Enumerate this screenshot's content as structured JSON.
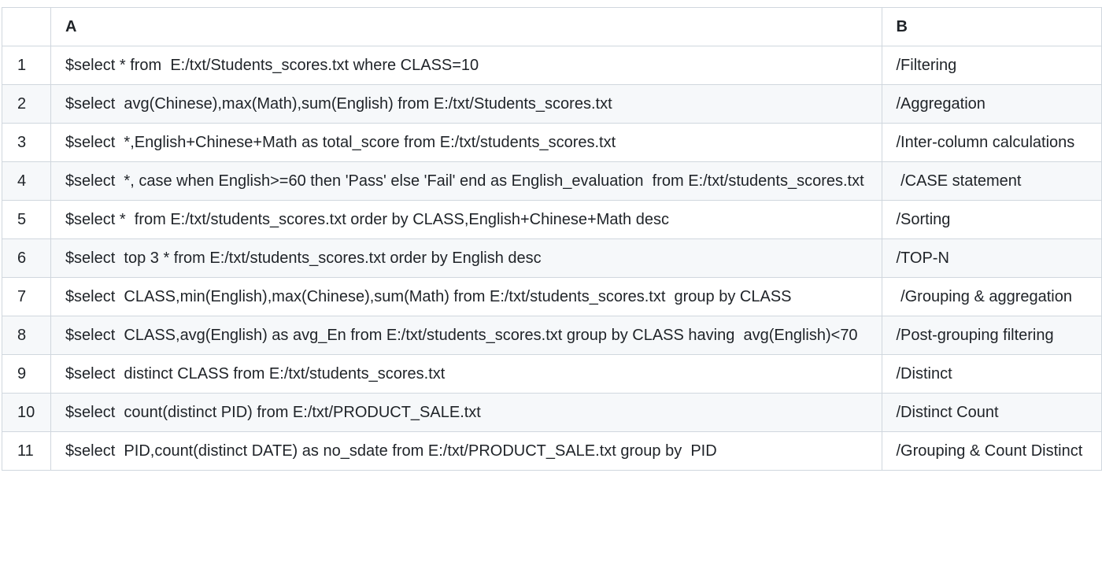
{
  "table": {
    "headers": [
      "",
      "A",
      "B"
    ],
    "rows": [
      {
        "num": "1",
        "a": "$select * from  E:/txt/Students_scores.txt where CLASS=10",
        "b": "/Filtering"
      },
      {
        "num": "2",
        "a": "$select  avg(Chinese),max(Math),sum(English) from E:/txt/Students_scores.txt",
        "b": "/Aggregation"
      },
      {
        "num": "3",
        "a": "$select  *,English+Chinese+Math as total_score from E:/txt/students_scores.txt",
        "b": "/Inter-column calculations"
      },
      {
        "num": "4",
        "a": "$select  *, case when English>=60 then 'Pass' else 'Fail' end as English_evaluation  from E:/txt/students_scores.txt",
        "b": " /CASE statement"
      },
      {
        "num": "5",
        "a": "$select *  from E:/txt/students_scores.txt order by CLASS,English+Chinese+Math desc",
        "b": "/Sorting"
      },
      {
        "num": "6",
        "a": "$select  top 3 * from E:/txt/students_scores.txt order by English desc",
        "b": "/TOP-N"
      },
      {
        "num": "7",
        "a": "$select  CLASS,min(English),max(Chinese),sum(Math) from E:/txt/students_scores.txt  group by CLASS",
        "b": " /Grouping & aggregation"
      },
      {
        "num": "8",
        "a": "$select  CLASS,avg(English) as avg_En from E:/txt/students_scores.txt group by CLASS having  avg(English)<70",
        "b": "/Post-grouping filtering"
      },
      {
        "num": "9",
        "a": "$select  distinct CLASS from E:/txt/students_scores.txt",
        "b": "/Distinct"
      },
      {
        "num": "10",
        "a": "$select  count(distinct PID) from E:/txt/PRODUCT_SALE.txt",
        "b": "/Distinct Count"
      },
      {
        "num": "11",
        "a": "$select  PID,count(distinct DATE) as no_sdate from E:/txt/PRODUCT_SALE.txt group by  PID",
        "b": "/Grouping & Count Distinct"
      }
    ]
  }
}
